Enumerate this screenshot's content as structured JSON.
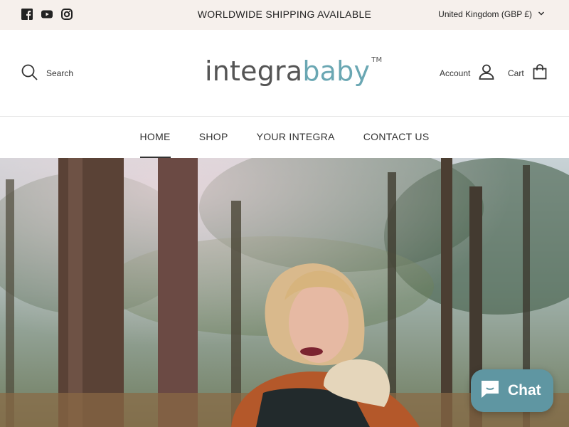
{
  "announcement": {
    "text": "WORLDWIDE SHIPPING AVAILABLE"
  },
  "social": [
    "facebook-icon",
    "youtube-icon",
    "instagram-icon"
  ],
  "currency": {
    "label": "United Kingdom (GBP £)"
  },
  "header": {
    "search_label": "Search",
    "logo_part1": "integra",
    "logo_part2": "baby",
    "logo_tm": "TM",
    "account_label": "Account",
    "cart_label": "Cart"
  },
  "nav": {
    "items": [
      {
        "label": "HOME",
        "active": true
      },
      {
        "label": "SHOP",
        "active": false
      },
      {
        "label": "YOUR INTEGRA",
        "active": false
      },
      {
        "label": "CONTACT US",
        "active": false
      }
    ]
  },
  "chat": {
    "label": "Chat"
  },
  "colors": {
    "topbar": "#f6f0ec",
    "brand_teal": "#6aa7b3",
    "chat_bg": "#5f96a2"
  }
}
